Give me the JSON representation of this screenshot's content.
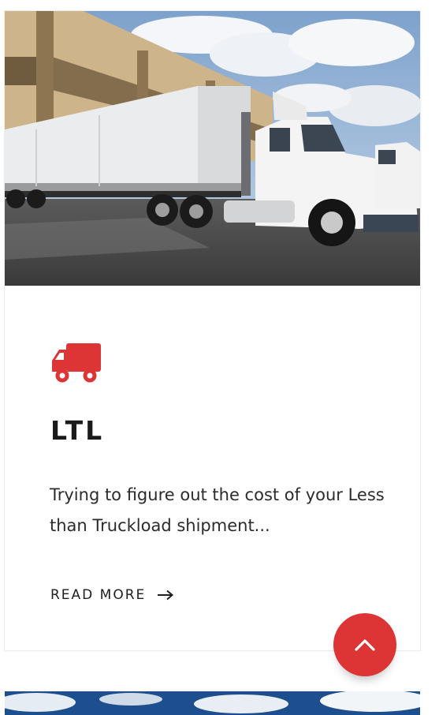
{
  "card": {
    "hero_image": "semi-truck-at-loading-dock-photo",
    "icon": "truck-icon",
    "title": "LTL",
    "description": "Trying to figure out the cost of your Less than Truckload shipment...",
    "read_more_label": "READ MORE",
    "read_more_icon": "arrow-right-icon"
  },
  "scroll_to_top": {
    "icon": "chevron-up-icon"
  },
  "next_card": {
    "image": "sky-with-clouds-photo"
  },
  "colors": {
    "accent": "#dd3535",
    "text": "#222222",
    "background": "#ffffff"
  }
}
